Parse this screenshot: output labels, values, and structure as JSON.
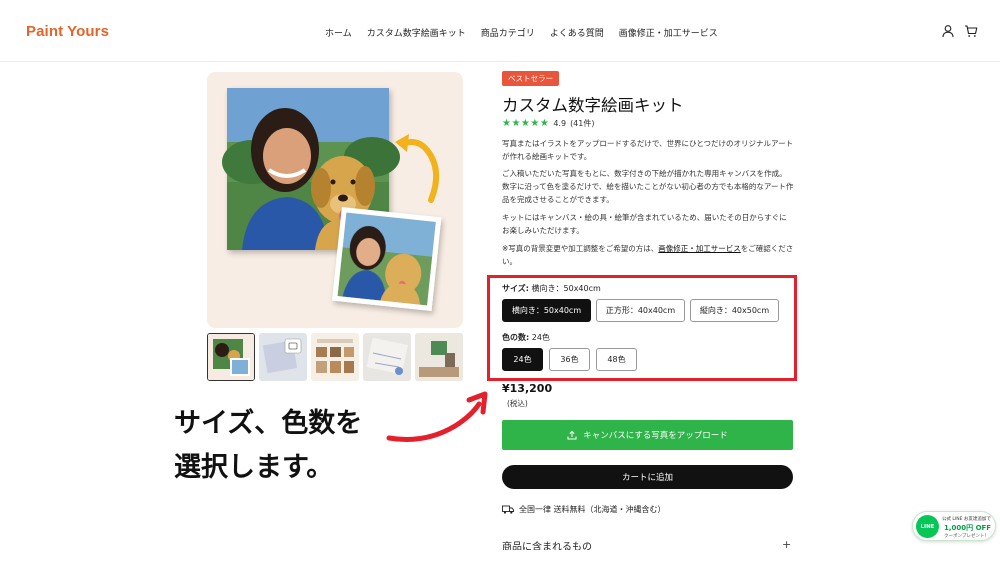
{
  "header": {
    "logo": "Paint Yours",
    "nav": [
      "ホーム",
      "カスタム数字絵画キット",
      "商品カテゴリ",
      "よくある質問",
      "画像修正・加工サービス"
    ],
    "icons": [
      "user-icon",
      "cart-icon"
    ]
  },
  "gallery": {
    "thumbnail_count": 5,
    "active_thumbnail": 0
  },
  "annotation": {
    "line1": "サイズ、色数を",
    "line2": "選択します。"
  },
  "product": {
    "badge": "ベストセラー",
    "title": "カスタム数字絵画キット",
    "rating_value": "4.9",
    "rating_count": "(41件)",
    "stars": 5,
    "desc1": "写真またはイラストをアップロードするだけで、世界にひとつだけのオリジナルアートが作れる絵画キットです。",
    "desc2": "ご入稿いただいた写真をもとに、数字付きの下絵が描かれた専用キャンバスを作成。数字に沿って色を塗るだけで、絵を描いたことがない初心者の方でも本格的なアート作品を完成させることができます。",
    "desc3": "キットにはキャンバス・絵の具・絵筆が含まれているため、届いたその日からすぐにお楽しみいただけます。",
    "desc4_pre": "※写真の背景変更や加工調整をご希望の方は、",
    "desc4_link": "画像修正・加工サービス",
    "desc4_post": "をご確認ください。"
  },
  "size": {
    "label": "サイズ:",
    "selected": "横向き：50x40cm",
    "options": [
      "横向き：50x40cm",
      "正方形：40x40cm",
      "縦向き：40x50cm"
    ]
  },
  "colors": {
    "label": "色の数:",
    "selected": "24色",
    "options": [
      "24色",
      "36色",
      "48色"
    ]
  },
  "price": {
    "amount": "¥13,200",
    "tax": "(税込)"
  },
  "buttons": {
    "upload": "キャンバスにする写真をアップロード",
    "cart": "カートに追加"
  },
  "shipping": "全国一律 送料無料（北海道・沖縄含む）",
  "accordion": "商品に含まれるもの",
  "line_banner": {
    "top": "公式 LINE お友達追加で",
    "amount": "1,000円 OFF",
    "bottom": "クーポンプレゼント！",
    "logo": "LINE"
  },
  "colors_theme": {
    "brand": "#e5642a",
    "highlight": "#e3202b",
    "cta": "#2fb44a",
    "stars": "#2fb84a"
  }
}
